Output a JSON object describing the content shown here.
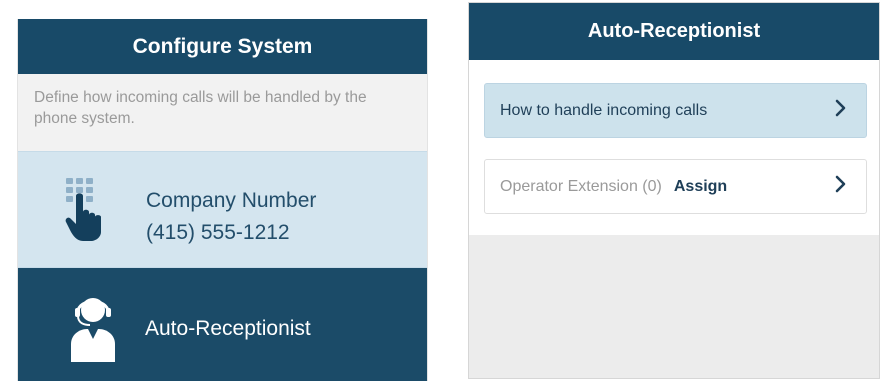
{
  "configure": {
    "title": "Configure System",
    "description": "Define how incoming calls will be handled by the phone system.",
    "company_number": {
      "label": "Company Number",
      "number": "(415) 555-1212",
      "icon": "keypad-tap-icon"
    },
    "auto_receptionist": {
      "label": "Auto-Receptionist",
      "icon": "receptionist-headset-icon"
    }
  },
  "auto_receptionist_screen": {
    "title": "Auto-Receptionist",
    "rows": [
      {
        "label": "How to handle incoming calls",
        "icon": "chevron-right-icon"
      },
      {
        "label": "Operator Extension (0)",
        "action": "Assign",
        "icon": "chevron-right-icon"
      }
    ]
  },
  "colors": {
    "header": "#184a68",
    "selected_row": "#d4e5ef",
    "text_dark": "#234e6b",
    "muted": "#9a9a9a"
  }
}
